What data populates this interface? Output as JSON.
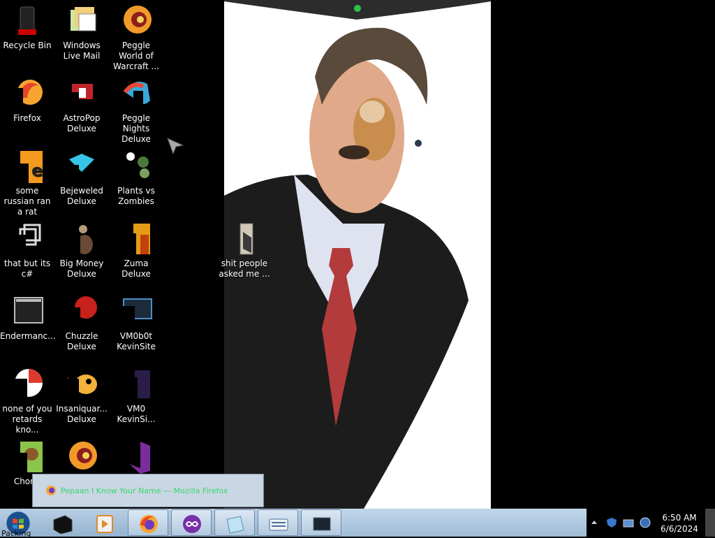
{
  "desktop": {
    "icons": [
      {
        "label": "Recycle Bin",
        "icon": "recycle-bin-icon"
      },
      {
        "label": "Windows Live Mail",
        "icon": "mail-icon"
      },
      {
        "label": "Peggle World of Warcraft ...",
        "icon": "peggle-icon"
      },
      {
        "label": "Firefox",
        "icon": "firefox-icon"
      },
      {
        "label": "AstroPop Deluxe",
        "icon": "astropop-icon"
      },
      {
        "label": "Peggle Nights Deluxe",
        "icon": "peggle-nights-icon"
      },
      {
        "label": "some russian ran a rat",
        "icon": "file-icon"
      },
      {
        "label": "Bejeweled Deluxe",
        "icon": "bejeweled-icon"
      },
      {
        "label": "Plants vs Zombies",
        "icon": "plants-vs-zombies-icon"
      },
      {
        "label": "that but its c#",
        "icon": "shortcut-icon"
      },
      {
        "label": "Big Money Deluxe",
        "icon": "big-money-icon"
      },
      {
        "label": "Zuma Deluxe",
        "icon": "zuma-icon"
      },
      {
        "label": "Endermanc...",
        "icon": "terminal-icon"
      },
      {
        "label": "Chuzzle Deluxe",
        "icon": "chuzzle-icon"
      },
      {
        "label": "VM0b0t KevinSite",
        "icon": "vm-icon"
      },
      {
        "label": "none of you retards kno...",
        "icon": "chrome-icon"
      },
      {
        "label": "Insaniquar... Deluxe",
        "icon": "insaniquarium-icon"
      },
      {
        "label": "VM0 KevinSi...",
        "icon": "vm-folder-icon"
      },
      {
        "label": "Chomi",
        "icon": "chomi-icon"
      },
      {
        "label": "",
        "icon": "peggle-icon"
      },
      {
        "label": "",
        "icon": "visual-studio-icon"
      }
    ],
    "folder_icon": {
      "label": "shit people asked me ...",
      "icon": "folder-icon"
    }
  },
  "tooltip": {
    "text": "Pepaan I Know Your Name — Mozilla Firefox"
  },
  "taskbar": {
    "start_label": "Packing",
    "buttons": [
      {
        "name": "task-app-1",
        "icon": "black-box-icon"
      },
      {
        "name": "task-media",
        "icon": "media-player-icon"
      },
      {
        "name": "task-firefox",
        "icon": "firefox-icon"
      },
      {
        "name": "task-infinity",
        "icon": "infinity-app-icon"
      },
      {
        "name": "task-notes",
        "icon": "notes-icon"
      },
      {
        "name": "task-keyboard",
        "icon": "keyboard-icon"
      },
      {
        "name": "task-screen",
        "icon": "screen-icon"
      }
    ],
    "clock": {
      "time": "6:50 AM",
      "date": "6/6/2024"
    }
  },
  "colors": {
    "taskbar": "#b8cfe5",
    "tooltip_text": "#37d96e"
  }
}
